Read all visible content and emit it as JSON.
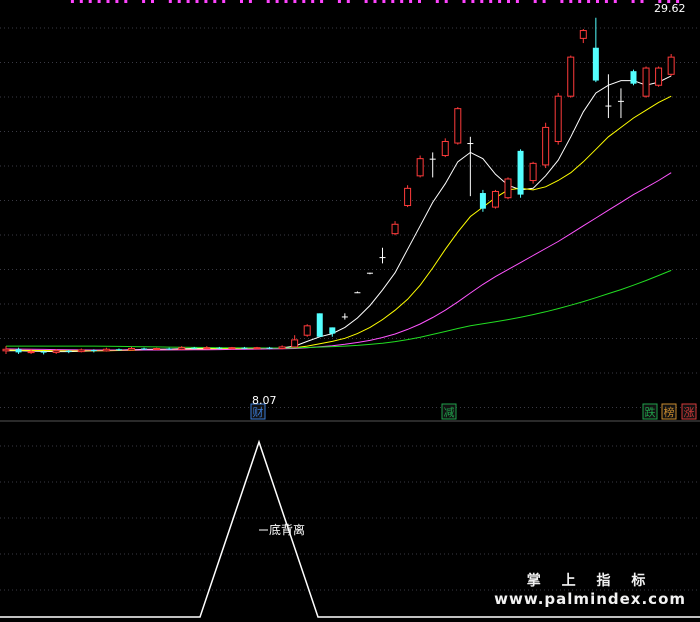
{
  "chart_data": [
    {
      "type": "candlestick",
      "title": "",
      "ylim": [
        4.0,
        30.5
      ],
      "price_high_label": "29.62",
      "price_low_label": "8.07",
      "grid": true,
      "candles": [
        {
          "o": 8.3,
          "c": 8.4,
          "h": 8.6,
          "l": 8.1,
          "dir": "up"
        },
        {
          "o": 8.4,
          "c": 8.2,
          "h": 8.5,
          "l": 8.1,
          "dir": "down"
        },
        {
          "o": 8.2,
          "c": 8.25,
          "h": 8.4,
          "l": 8.1,
          "dir": "up"
        },
        {
          "o": 8.25,
          "c": 8.2,
          "h": 8.3,
          "l": 8.07,
          "dir": "down"
        },
        {
          "o": 8.2,
          "c": 8.3,
          "h": 8.4,
          "l": 8.1,
          "dir": "up"
        },
        {
          "o": 8.3,
          "c": 8.25,
          "h": 8.35,
          "l": 8.15,
          "dir": "down"
        },
        {
          "o": 8.25,
          "c": 8.35,
          "h": 8.45,
          "l": 8.2,
          "dir": "up"
        },
        {
          "o": 8.35,
          "c": 8.3,
          "h": 8.4,
          "l": 8.2,
          "dir": "down"
        },
        {
          "o": 8.3,
          "c": 8.4,
          "h": 8.5,
          "l": 8.25,
          "dir": "up"
        },
        {
          "o": 8.4,
          "c": 8.35,
          "h": 8.45,
          "l": 8.3,
          "dir": "down"
        },
        {
          "o": 8.35,
          "c": 8.45,
          "h": 8.55,
          "l": 8.3,
          "dir": "up"
        },
        {
          "o": 8.45,
          "c": 8.4,
          "h": 8.5,
          "l": 8.35,
          "dir": "down"
        },
        {
          "o": 8.4,
          "c": 8.45,
          "h": 8.5,
          "l": 8.35,
          "dir": "up"
        },
        {
          "o": 8.45,
          "c": 8.4,
          "h": 8.5,
          "l": 8.35,
          "dir": "down"
        },
        {
          "o": 8.4,
          "c": 8.5,
          "h": 8.6,
          "l": 8.35,
          "dir": "up"
        },
        {
          "o": 8.5,
          "c": 8.45,
          "h": 8.55,
          "l": 8.4,
          "dir": "down"
        },
        {
          "o": 8.45,
          "c": 8.5,
          "h": 8.6,
          "l": 8.4,
          "dir": "up"
        },
        {
          "o": 8.5,
          "c": 8.45,
          "h": 8.55,
          "l": 8.4,
          "dir": "down"
        },
        {
          "o": 8.45,
          "c": 8.5,
          "h": 8.55,
          "l": 8.4,
          "dir": "up"
        },
        {
          "o": 8.5,
          "c": 8.45,
          "h": 8.55,
          "l": 8.4,
          "dir": "down"
        },
        {
          "o": 8.45,
          "c": 8.5,
          "h": 8.55,
          "l": 8.4,
          "dir": "up"
        },
        {
          "o": 8.5,
          "c": 8.45,
          "h": 8.55,
          "l": 8.4,
          "dir": "down"
        },
        {
          "o": 8.45,
          "c": 8.55,
          "h": 8.65,
          "l": 8.4,
          "dir": "up"
        },
        {
          "o": 8.55,
          "c": 9.0,
          "h": 9.3,
          "l": 8.5,
          "dir": "up"
        },
        {
          "o": 9.3,
          "c": 9.9,
          "h": 10.0,
          "l": 9.2,
          "dir": "up"
        },
        {
          "o": 10.7,
          "c": 9.2,
          "h": 10.7,
          "l": 9.2,
          "dir": "down"
        },
        {
          "o": 9.8,
          "c": 9.4,
          "h": 9.8,
          "l": 9.2,
          "dir": "down"
        },
        {
          "o": 10.5,
          "c": 10.45,
          "h": 10.7,
          "l": 10.3,
          "dir": "flat"
        },
        {
          "o": 12.05,
          "c": 12.0,
          "h": 12.1,
          "l": 12.0,
          "dir": "flat"
        },
        {
          "o": 13.3,
          "c": 13.25,
          "h": 13.3,
          "l": 13.2,
          "dir": "flat"
        },
        {
          "o": 14.3,
          "c": 14.25,
          "h": 14.9,
          "l": 13.9,
          "dir": "flat"
        },
        {
          "o": 15.8,
          "c": 16.4,
          "h": 16.6,
          "l": 15.7,
          "dir": "up"
        },
        {
          "o": 17.6,
          "c": 18.7,
          "h": 18.9,
          "l": 17.5,
          "dir": "up"
        },
        {
          "o": 19.5,
          "c": 20.6,
          "h": 20.8,
          "l": 19.4,
          "dir": "up"
        },
        {
          "o": 20.6,
          "c": 20.6,
          "h": 21.0,
          "l": 19.4,
          "dir": "flat"
        },
        {
          "o": 20.8,
          "c": 21.7,
          "h": 21.9,
          "l": 20.7,
          "dir": "up"
        },
        {
          "o": 21.6,
          "c": 23.8,
          "h": 23.9,
          "l": 21.5,
          "dir": "up"
        },
        {
          "o": 21.6,
          "c": 21.6,
          "h": 22.0,
          "l": 18.2,
          "dir": "flat"
        },
        {
          "o": 17.4,
          "c": 18.4,
          "h": 18.6,
          "l": 17.2,
          "dir": "down"
        },
        {
          "o": 17.5,
          "c": 18.5,
          "h": 18.6,
          "l": 17.4,
          "dir": "up"
        },
        {
          "o": 18.1,
          "c": 19.3,
          "h": 19.4,
          "l": 18.0,
          "dir": "up"
        },
        {
          "o": 21.1,
          "c": 18.3,
          "h": 21.2,
          "l": 18.1,
          "dir": "down"
        },
        {
          "o": 19.2,
          "c": 20.3,
          "h": 20.4,
          "l": 19.0,
          "dir": "up"
        },
        {
          "o": 20.2,
          "c": 22.6,
          "h": 22.9,
          "l": 20.0,
          "dir": "up"
        },
        {
          "o": 21.7,
          "c": 24.6,
          "h": 24.8,
          "l": 21.5,
          "dir": "up"
        },
        {
          "o": 24.6,
          "c": 27.1,
          "h": 27.2,
          "l": 24.5,
          "dir": "up"
        },
        {
          "o": 28.3,
          "c": 28.8,
          "h": 28.9,
          "l": 28.0,
          "dir": "up"
        },
        {
          "o": 27.7,
          "c": 25.6,
          "h": 29.62,
          "l": 25.5,
          "dir": "down"
        },
        {
          "o": 24.0,
          "c": 24.0,
          "h": 26.0,
          "l": 23.2,
          "dir": "flat"
        },
        {
          "o": 24.3,
          "c": 24.3,
          "h": 25.1,
          "l": 23.2,
          "dir": "flat"
        },
        {
          "o": 26.2,
          "c": 25.4,
          "h": 26.3,
          "l": 25.3,
          "dir": "down"
        },
        {
          "o": 24.6,
          "c": 26.4,
          "h": 26.5,
          "l": 24.5,
          "dir": "up"
        },
        {
          "o": 25.3,
          "c": 26.4,
          "h": 26.5,
          "l": 25.2,
          "dir": "up"
        },
        {
          "o": 26.0,
          "c": 27.1,
          "h": 27.3,
          "l": 25.9,
          "dir": "up"
        }
      ],
      "ma_lines": [
        {
          "color": "#ffffff",
          "values": [
            8.3,
            8.3,
            8.28,
            8.26,
            8.25,
            8.25,
            8.27,
            8.3,
            8.32,
            8.35,
            8.37,
            8.39,
            8.4,
            8.41,
            8.43,
            8.45,
            8.46,
            8.47,
            8.47,
            8.48,
            8.48,
            8.48,
            8.49,
            8.6,
            8.9,
            9.2,
            9.4,
            9.8,
            10.4,
            11.2,
            12.2,
            13.3,
            14.8,
            16.3,
            17.8,
            19.0,
            20.4,
            21.0,
            20.6,
            19.6,
            18.9,
            18.6,
            18.7,
            19.5,
            20.5,
            22.0,
            23.6,
            24.8,
            25.3,
            25.6,
            25.6,
            25.3,
            25.5,
            25.9
          ]
        },
        {
          "color": "#ffff00",
          "values": [
            8.35,
            8.34,
            8.33,
            8.32,
            8.31,
            8.3,
            8.3,
            8.3,
            8.31,
            8.32,
            8.33,
            8.35,
            8.36,
            8.37,
            8.39,
            8.4,
            8.42,
            8.43,
            8.44,
            8.45,
            8.45,
            8.46,
            8.46,
            8.5,
            8.6,
            8.75,
            8.9,
            9.1,
            9.4,
            9.8,
            10.3,
            10.9,
            11.6,
            12.5,
            13.6,
            14.8,
            15.9,
            16.9,
            17.5,
            18.1,
            18.6,
            18.7,
            18.6,
            18.8,
            19.2,
            19.7,
            20.4,
            21.2,
            22.0,
            22.6,
            23.2,
            23.7,
            24.2,
            24.6
          ]
        },
        {
          "color": "#ff55ff",
          "values": [
            8.42,
            8.41,
            8.4,
            8.39,
            8.38,
            8.37,
            8.36,
            8.35,
            8.35,
            8.35,
            8.35,
            8.35,
            8.35,
            8.36,
            8.36,
            8.37,
            8.37,
            8.38,
            8.39,
            8.4,
            8.41,
            8.42,
            8.43,
            8.45,
            8.5,
            8.56,
            8.63,
            8.72,
            8.83,
            8.97,
            9.15,
            9.38,
            9.67,
            10.02,
            10.43,
            10.9,
            11.43,
            12.0,
            12.55,
            13.05,
            13.5,
            13.95,
            14.4,
            14.85,
            15.3,
            15.8,
            16.3,
            16.8,
            17.3,
            17.8,
            18.3,
            18.75,
            19.2,
            19.7
          ]
        },
        {
          "color": "#22dd22",
          "values": [
            8.6,
            8.6,
            8.6,
            8.6,
            8.6,
            8.6,
            8.6,
            8.6,
            8.59,
            8.58,
            8.57,
            8.56,
            8.55,
            8.54,
            8.53,
            8.52,
            8.51,
            8.5,
            8.5,
            8.49,
            8.49,
            8.48,
            8.48,
            8.49,
            8.51,
            8.54,
            8.57,
            8.6,
            8.65,
            8.71,
            8.79,
            8.89,
            9.02,
            9.17,
            9.35,
            9.54,
            9.73,
            9.9,
            10.03,
            10.16,
            10.3,
            10.45,
            10.62,
            10.8,
            11.0,
            11.22,
            11.45,
            11.7,
            11.96,
            12.22,
            12.5,
            12.8,
            13.12,
            13.45
          ]
        }
      ],
      "event_markers": [
        {
          "label": "财",
          "bar_index": 4,
          "color": "#3a7bd5"
        },
        {
          "label": "减",
          "bar_index": 29,
          "color": "#1fa04a"
        },
        {
          "label": "跌",
          "bar_index": 48,
          "color": "#1fa04a"
        },
        {
          "label": "榜",
          "bar_index": 50,
          "color": "#c88a2e"
        },
        {
          "label": "涨",
          "bar_index": 52,
          "color": "#d33a3a"
        }
      ]
    },
    {
      "type": "line",
      "title": "",
      "signal_label": "底背离",
      "ylim": [
        0,
        1
      ],
      "x": [
        0,
        1,
        2,
        3,
        4,
        5,
        6,
        7,
        8
      ],
      "values": [
        0,
        0,
        0,
        0,
        1,
        0,
        0,
        0,
        0
      ]
    }
  ],
  "top_marks": {
    "color": "#ff44ff",
    "count": 70
  },
  "watermark": {
    "line1": "掌 上 指 标",
    "line2": "www.palmindex.com"
  }
}
